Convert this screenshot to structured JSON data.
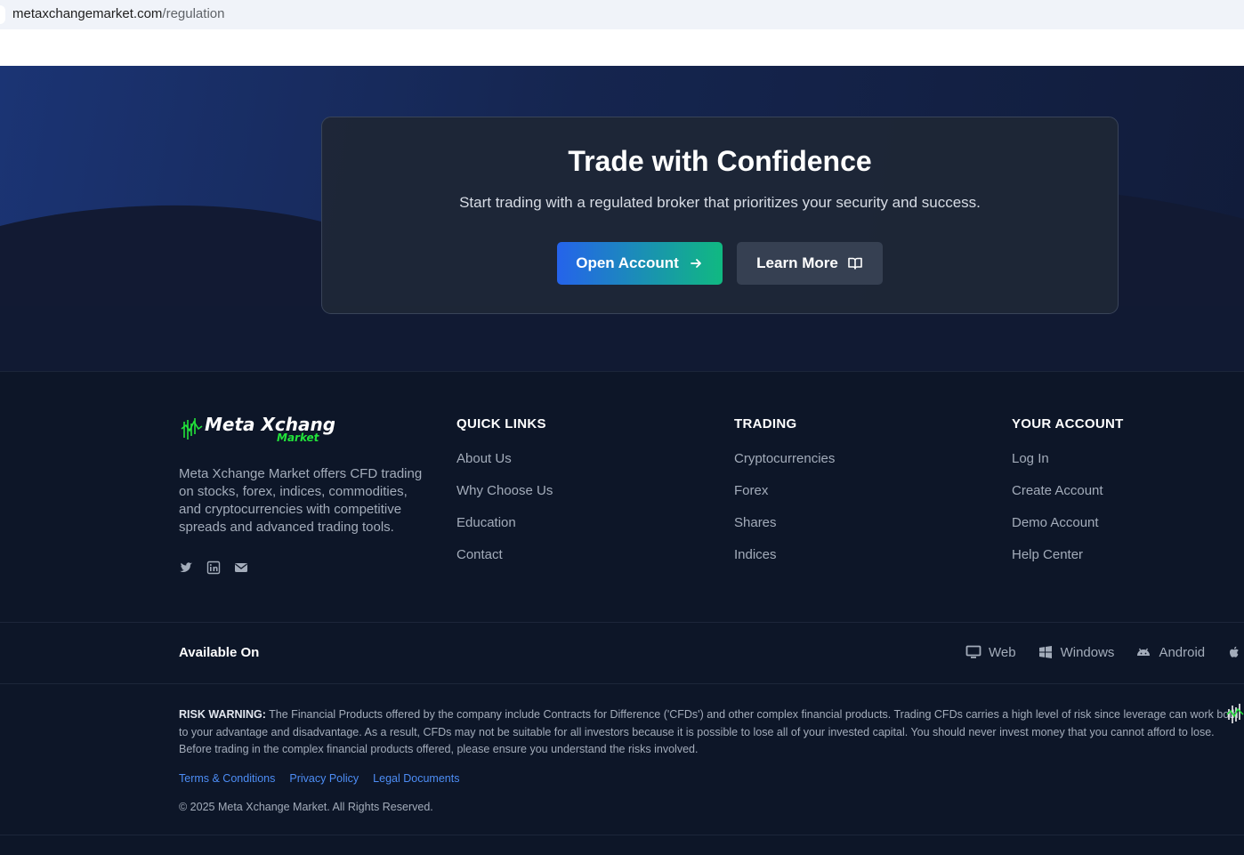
{
  "browser": {
    "url_host": "metaxchangemarket.com",
    "url_path": "/regulation"
  },
  "cta": {
    "title": "Trade with Confidence",
    "subtitle": "Start trading with a regulated broker that prioritizes your security and success.",
    "open_account": "Open Account",
    "learn_more": "Learn More"
  },
  "footer": {
    "logo_text": "Meta Xchange",
    "logo_sub": "Market",
    "about": "Meta Xchange Market offers CFD trading on stocks, forex, indices, commodities, and cryptocurrencies with competitive spreads and advanced trading tools.",
    "socials": [
      "twitter-icon",
      "linkedin-icon",
      "mail-icon"
    ],
    "columns": [
      {
        "title": "QUICK LINKS",
        "items": [
          "About Us",
          "Why Choose Us",
          "Education",
          "Contact"
        ]
      },
      {
        "title": "TRADING",
        "items": [
          "Cryptocurrencies",
          "Forex",
          "Shares",
          "Indices"
        ]
      },
      {
        "title": "YOUR ACCOUNT",
        "items": [
          "Log In",
          "Create Account",
          "Demo Account",
          "Help Center"
        ]
      }
    ],
    "available_on": "Available On",
    "platforms": [
      "Web",
      "Windows",
      "Android",
      "i"
    ],
    "risk_label": "RISK WARNING:",
    "risk_text": "The Financial Products offered by the company include Contracts for Difference ('CFDs') and other complex financial products. Trading CFDs carries a high level of risk since leverage can work both to your advantage and disadvantage. As a result, CFDs may not be suitable for all investors because it is possible to lose all of your invested capital. You should never invest money that you cannot afford to lose. Before trading in the complex financial products offered, please ensure you understand the risks involved.",
    "legal_links": [
      "Terms & Conditions",
      "Privacy Policy",
      "Legal Documents"
    ],
    "copyright": "© 2025 Meta Xchange Market. All Rights Reserved."
  },
  "colors": {
    "accent_blue": "#2563eb",
    "accent_green": "#10b981",
    "logo_green": "#22e33a",
    "link": "#4d8df5"
  }
}
